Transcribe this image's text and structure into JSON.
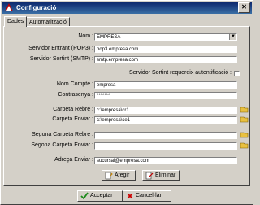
{
  "window": {
    "title": "Configuració",
    "close_glyph": "✕"
  },
  "tabs": [
    {
      "label": "Dades"
    },
    {
      "label": "Automatització"
    }
  ],
  "form": {
    "nom_label": "Nom :",
    "nom_value": "EMPRESA",
    "servidor_entrant_label": "Servidor Entrant (POP3) :",
    "servidor_entrant_value": "pop3.empresa.com",
    "servidor_sortint_label": "Servidor Sortint (SMTP) :",
    "servidor_sortint_value": "smtp.empresa.com",
    "autentificacio_label": "Servidor Sortint requereix autentificació :",
    "autentificacio_checked": false,
    "nom_compte_label": "Nom Compte :",
    "nom_compte_value": "empresa",
    "contrasenya_label": "Contrasenya :",
    "contrasenya_value": "*******",
    "carpeta_rebre_label": "Carpeta Rebre :",
    "carpeta_rebre_value": "c:\\empresa\\cr1",
    "carpeta_enviar_label": "Carpeta Enviar :",
    "carpeta_enviar_value": "c:\\empresa\\ce1",
    "segona_rebre_label": "Segona Carpeta Rebre :",
    "segona_rebre_value": "",
    "segona_enviar_label": "Segona Carpeta Enviar :",
    "segona_enviar_value": "",
    "adreca_label": "Adreça Enviar :",
    "adreca_value": "sucursal@empresa.com"
  },
  "buttons": {
    "afegir": "Afegir",
    "eliminar": "Eliminar",
    "acceptar": "Acceptar",
    "cancelar": "Cancel·lar"
  },
  "colors": {
    "title_bar": "#0a246a",
    "face": "#d4d0c8",
    "accept_green": "#1a8a1a",
    "cancel_red": "#cc0000",
    "folder_yellow": "#e8c040"
  }
}
